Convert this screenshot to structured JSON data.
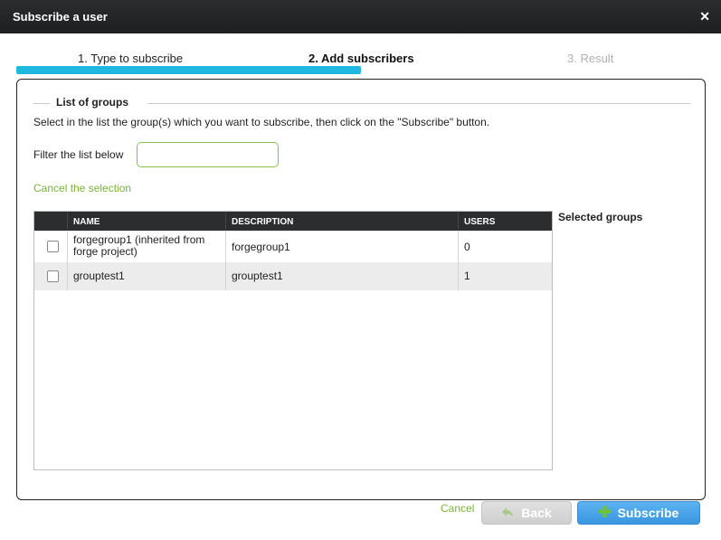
{
  "dialog": {
    "title": "Subscribe a user",
    "close_icon": "close-icon"
  },
  "steps": [
    {
      "label": "1. Type to subscribe"
    },
    {
      "label": "2. Add subscribers"
    },
    {
      "label": "3. Result"
    }
  ],
  "progress_fraction": 0.5,
  "groups_section": {
    "legend": "List of groups",
    "instructions": "Select in the list the group(s) which you want to subscribe, then click on the \"Subscribe\" button.",
    "filter_label": "Filter the list below",
    "filter_value": "",
    "cancel_selection": "Cancel the selection",
    "selected_groups_label": "Selected groups"
  },
  "table": {
    "columns": [
      "NAME",
      "DESCRIPTION",
      "USERS"
    ],
    "rows": [
      {
        "name_line1": "forgegroup1 (inherited from",
        "name_line2": "forge project)",
        "description": "forgegroup1",
        "users": "0",
        "checked": false
      },
      {
        "name_line1": "grouptest1",
        "name_line2": "",
        "description": "grouptest1",
        "users": "1",
        "checked": false
      }
    ]
  },
  "footer": {
    "cancel": "Cancel",
    "back": "Back",
    "back_icon": "back-arrow-icon",
    "subscribe": "Subscribe",
    "subscribe_icon": "plus-icon"
  },
  "colors": {
    "accent_green": "#7ab43a",
    "progress_blue": "#1fb8e0",
    "subscribe_blue": "#3a96e0",
    "header_dark": "#2b2d2f"
  }
}
